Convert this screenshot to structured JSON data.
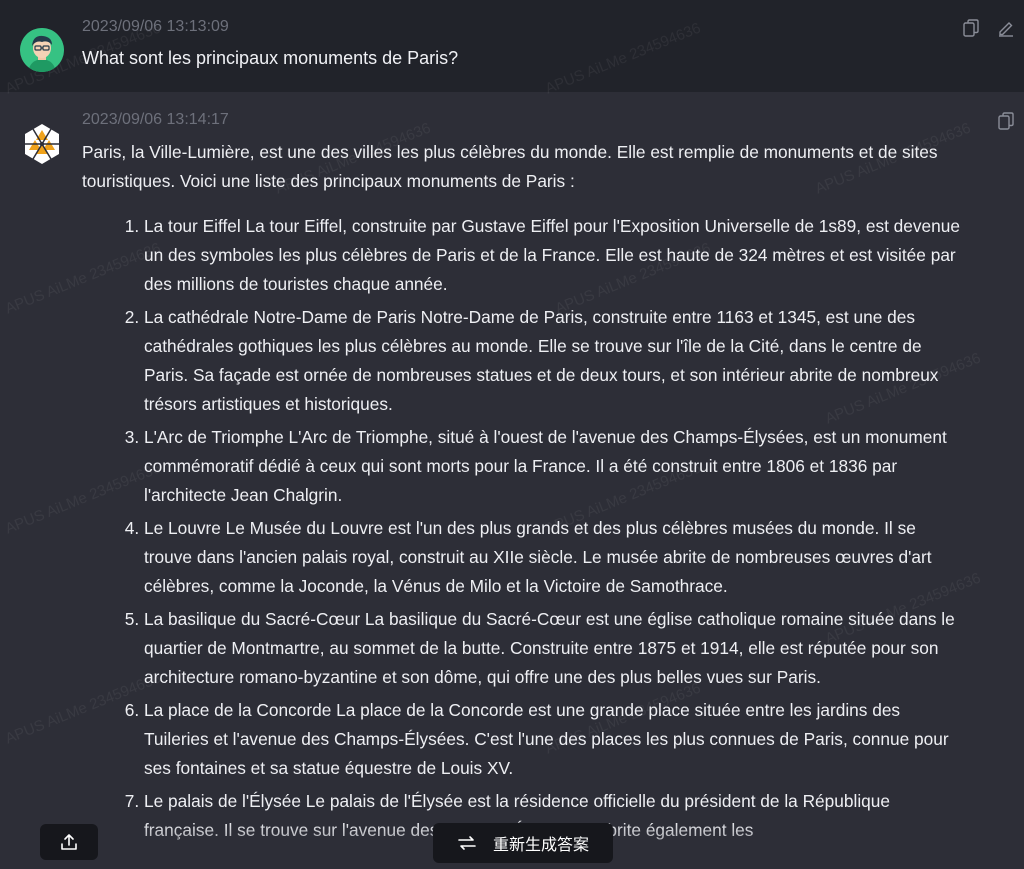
{
  "user_message": {
    "timestamp": "2023/09/06 13:13:09",
    "text": "What sont les principaux monuments de Paris?",
    "avatar_icon": "user-avatar-icon"
  },
  "ai_message": {
    "timestamp": "2023/09/06 13:14:17",
    "intro": "Paris, la Ville-Lumière, est une des villes les plus célèbres du monde. Elle est remplie de monuments et de sites touristiques. Voici une liste des principaux monuments de Paris :",
    "items": [
      "La tour Eiffel La tour Eiffel, construite par Gustave Eiffel pour l'Exposition Universelle de 1s89, est devenue un des symboles les plus célèbres de Paris et de la France. Elle est haute de 324 mètres et est visitée par des millions de touristes chaque année.",
      "La cathédrale Notre-Dame de Paris Notre-Dame de Paris, construite entre 1163 et 1345, est une des cathédrales gothiques les plus célèbres au monde. Elle se trouve sur l'île de la Cité, dans le centre de Paris. Sa façade est ornée de nombreuses statues et de deux tours, et son intérieur abrite de nombreux trésors artistiques et historiques.",
      "L'Arc de Triomphe L'Arc de Triomphe, situé à l'ouest de l'avenue des Champs-Élysées, est un monument commémoratif dédié à ceux qui sont morts pour la France. Il a été construit entre 1806 et 1836 par l'architecte Jean Chalgrin.",
      "Le Louvre Le Musée du Louvre est l'un des plus grands et des plus célèbres musées du monde. Il se trouve dans l'ancien palais royal, construit au XIIe siècle. Le musée abrite de nombreuses œuvres d'art célèbres, comme la Joconde, la Vénus de Milo et la Victoire de Samothrace.",
      "La basilique du Sacré-Cœur La basilique du Sacré-Cœur est une église catholique romaine située dans le quartier de Montmartre, au sommet de la butte. Construite entre 1875 et 1914, elle est réputée pour son architecture romano-byzantine et son dôme, qui offre une des plus belles vues sur Paris.",
      "La place de la Concorde La place de la Concorde est une grande place située entre les jardins des Tuileries et l'avenue des Champs-Élysées. C'est l'une des places les plus connues de Paris, connue pour ses fontaines et sa statue équestre de Louis XV.",
      "Le palais de l'Élysée Le palais de l'Élysée est la résidence officielle du président de la République française. Il se trouve sur l'avenue des Champs-Élysées et abrite également les"
    ]
  },
  "watermark_text": "APUS AiLMe 234594636",
  "controls": {
    "regenerate_label": "重新生成答案",
    "copy_icon": "copy-icon",
    "edit_icon": "edit-icon",
    "share_icon": "share-icon",
    "refresh_icon": "refresh-icon"
  },
  "colors": {
    "user_bg": "#21232a",
    "ai_bg": "#2d2e37",
    "button_bg": "#16171c",
    "ai_logo_orange": "#f0a21b"
  }
}
